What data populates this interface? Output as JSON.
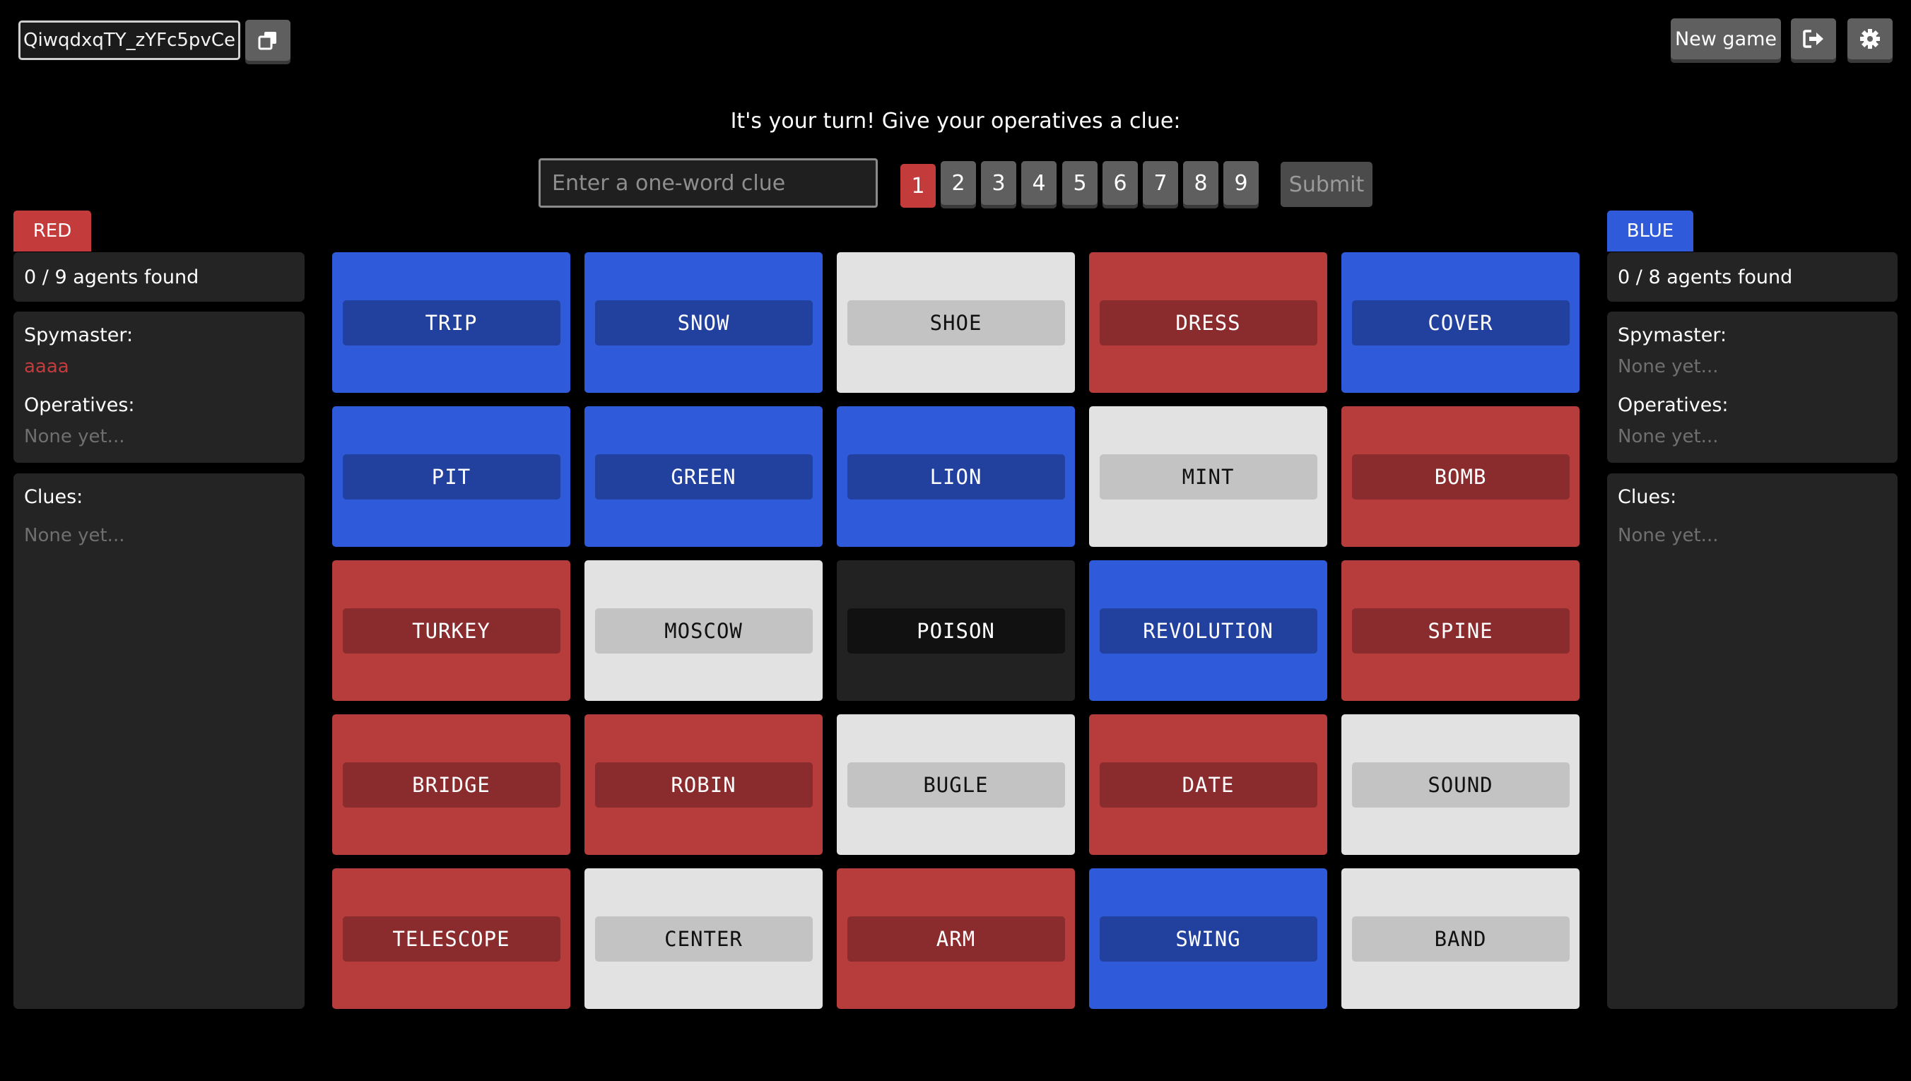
{
  "header": {
    "game_id": "QiwqdxqTY_zYFc5pvCe",
    "copy_icon": "copy-icon",
    "new_game_label": "New game",
    "exit_icon": "sign-out-icon",
    "settings_icon": "gear-icon"
  },
  "clue": {
    "turn_message": "It's your turn! Give your operatives a clue:",
    "input_placeholder": "Enter a one-word clue",
    "input_value": "",
    "numbers": [
      "1",
      "2",
      "3",
      "4",
      "5",
      "6",
      "7",
      "8",
      "9"
    ],
    "selected_number": "1",
    "submit_label": "Submit"
  },
  "red_team": {
    "tab_label": "RED",
    "found": "0 / 9 agents found",
    "spymaster_label": "Spymaster:",
    "spymaster_name": "aaaa",
    "operatives_label": "Operatives:",
    "operatives_value": "None yet...",
    "clues_label": "Clues:",
    "clues_value": "None yet..."
  },
  "blue_team": {
    "tab_label": "BLUE",
    "found": "0 / 8 agents found",
    "spymaster_label": "Spymaster:",
    "spymaster_name": "None yet...",
    "operatives_label": "Operatives:",
    "operatives_value": "None yet...",
    "clues_label": "Clues:",
    "clues_value": "None yet..."
  },
  "colors": {
    "red": "#b73c3c",
    "blue": "#2f5ad9",
    "neutral": "#e2e2e2",
    "assassin": "#222222"
  },
  "board": {
    "cards": [
      {
        "word": "TRIP",
        "team": "blue"
      },
      {
        "word": "SNOW",
        "team": "blue"
      },
      {
        "word": "SHOE",
        "team": "neutral"
      },
      {
        "word": "DRESS",
        "team": "red"
      },
      {
        "word": "COVER",
        "team": "blue"
      },
      {
        "word": "PIT",
        "team": "blue"
      },
      {
        "word": "GREEN",
        "team": "blue"
      },
      {
        "word": "LION",
        "team": "blue"
      },
      {
        "word": "MINT",
        "team": "neutral"
      },
      {
        "word": "BOMB",
        "team": "red"
      },
      {
        "word": "TURKEY",
        "team": "red"
      },
      {
        "word": "MOSCOW",
        "team": "neutral"
      },
      {
        "word": "POISON",
        "team": "assassin"
      },
      {
        "word": "REVOLUTION",
        "team": "blue"
      },
      {
        "word": "SPINE",
        "team": "red"
      },
      {
        "word": "BRIDGE",
        "team": "red"
      },
      {
        "word": "ROBIN",
        "team": "red"
      },
      {
        "word": "BUGLE",
        "team": "neutral"
      },
      {
        "word": "DATE",
        "team": "red"
      },
      {
        "word": "SOUND",
        "team": "neutral"
      },
      {
        "word": "TELESCOPE",
        "team": "red"
      },
      {
        "word": "CENTER",
        "team": "neutral"
      },
      {
        "word": "ARM",
        "team": "red"
      },
      {
        "word": "SWING",
        "team": "blue"
      },
      {
        "word": "BAND",
        "team": "neutral"
      }
    ]
  }
}
